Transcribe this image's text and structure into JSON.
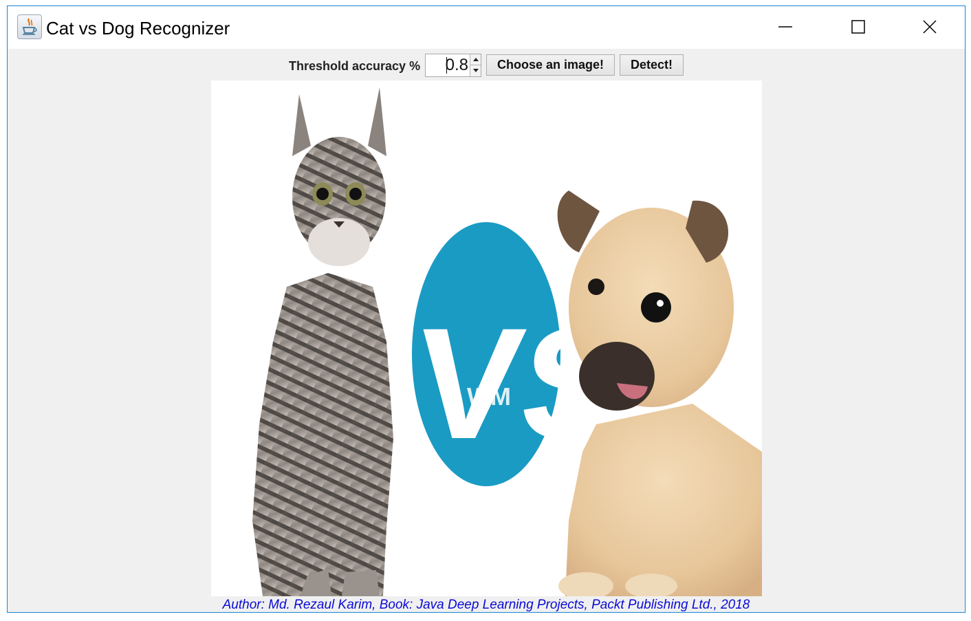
{
  "window": {
    "title": "Cat vs Dog Recognizer",
    "app_icon": "java-coffee-icon",
    "controls": [
      "minimize-icon",
      "maximize-icon",
      "close-icon"
    ],
    "border_color": "#1883d7"
  },
  "toolbar": {
    "threshold_label": "Threshold accuracy %",
    "threshold_value": "0.8",
    "choose_label": "Choose an image!",
    "detect_label": "Detect!"
  },
  "image": {
    "vs_text": "VS",
    "watermark_text": "WM",
    "vs_color": "#1a9bc4"
  },
  "footer": {
    "author": "Author: Md. Rezaul Karim, Book: Java Deep Learning Projects, Packt Publishing Ltd., 2018",
    "author_color": "#0a0ad6"
  }
}
